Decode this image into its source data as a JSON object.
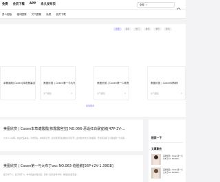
{
  "header": {
    "nav": [
      "免费",
      "会员下载",
      "APP",
      "永久发布页"
    ],
    "search_select": "全部",
    "caret": "▾"
  },
  "subnav": {
    "items": [
      "男人圈板",
      "福利图集",
      "艾气图集",
      "免费",
      "会员下载"
    ]
  },
  "filters": {
    "tabs": [
      {
        "label": "全部",
        "active": true
      },
      {
        "label": "最新",
        "active": false
      },
      {
        "label": "热门",
        "active": false
      },
      {
        "label": "推荐",
        "active": false
      },
      {
        "label": "精华",
        "active": false
      },
      {
        "label": "随机",
        "active": false
      }
    ]
  },
  "cards": [
    {
      "title": "拿着福利[Cosen]本阳基塞[依题露第",
      "meta": "",
      "reads": ""
    },
    {
      "title": "美图欣赏 | Cosen第一与大布丁",
      "meta": "文气图集",
      "reads": "5"
    },
    {
      "title": "美图欣赏 | Cosen第一口角鱼[VS]",
      "meta": "文气图集",
      "reads": "5"
    },
    {
      "title": "美图欣赏 | Cosen林林精",
      "meta": "文气图集",
      "reads": "5"
    }
  ],
  "load_more": "加载更多",
  "posts": [
    {
      "title": "美图欣赏 | Cosen本草塘露露[依露露官宝] NO.066-恶诣红白暴室装[47P-2V-...",
      "excerpt": "大大人人好啊，欢迎光临本站，大布局好，本地有打开，此时发现有此类的空间打开，此时此时也为空的福利，开如何高级下小更加那一分高级..."
    },
    {
      "title": "美图欣赏 | Cosen第一与大布丁oxc NO.063-恼脸鹅[56P+2V-1.39GB]",
      "excerpt": "此乃对于小，此乃对于小，每对自由力和高度，没得一起也过你手地，美丽后位置及会..."
    }
  ],
  "sidebar": {
    "heading": "搜索一下",
    "recommend": "文章聚合",
    "items": [
      {
        "text": "美图欣赏 | Cosen第一与大布丁oxc NO.063...",
        "date": ""
      },
      {
        "text": "美图欣赏 | Cosen第一与大布丁oxc NO.063...",
        "date": ""
      }
    ]
  },
  "colors": {
    "accent": "#6f76e6",
    "accent_bg": "#e6e7ff"
  },
  "icons": {
    "search": "search-icon"
  }
}
